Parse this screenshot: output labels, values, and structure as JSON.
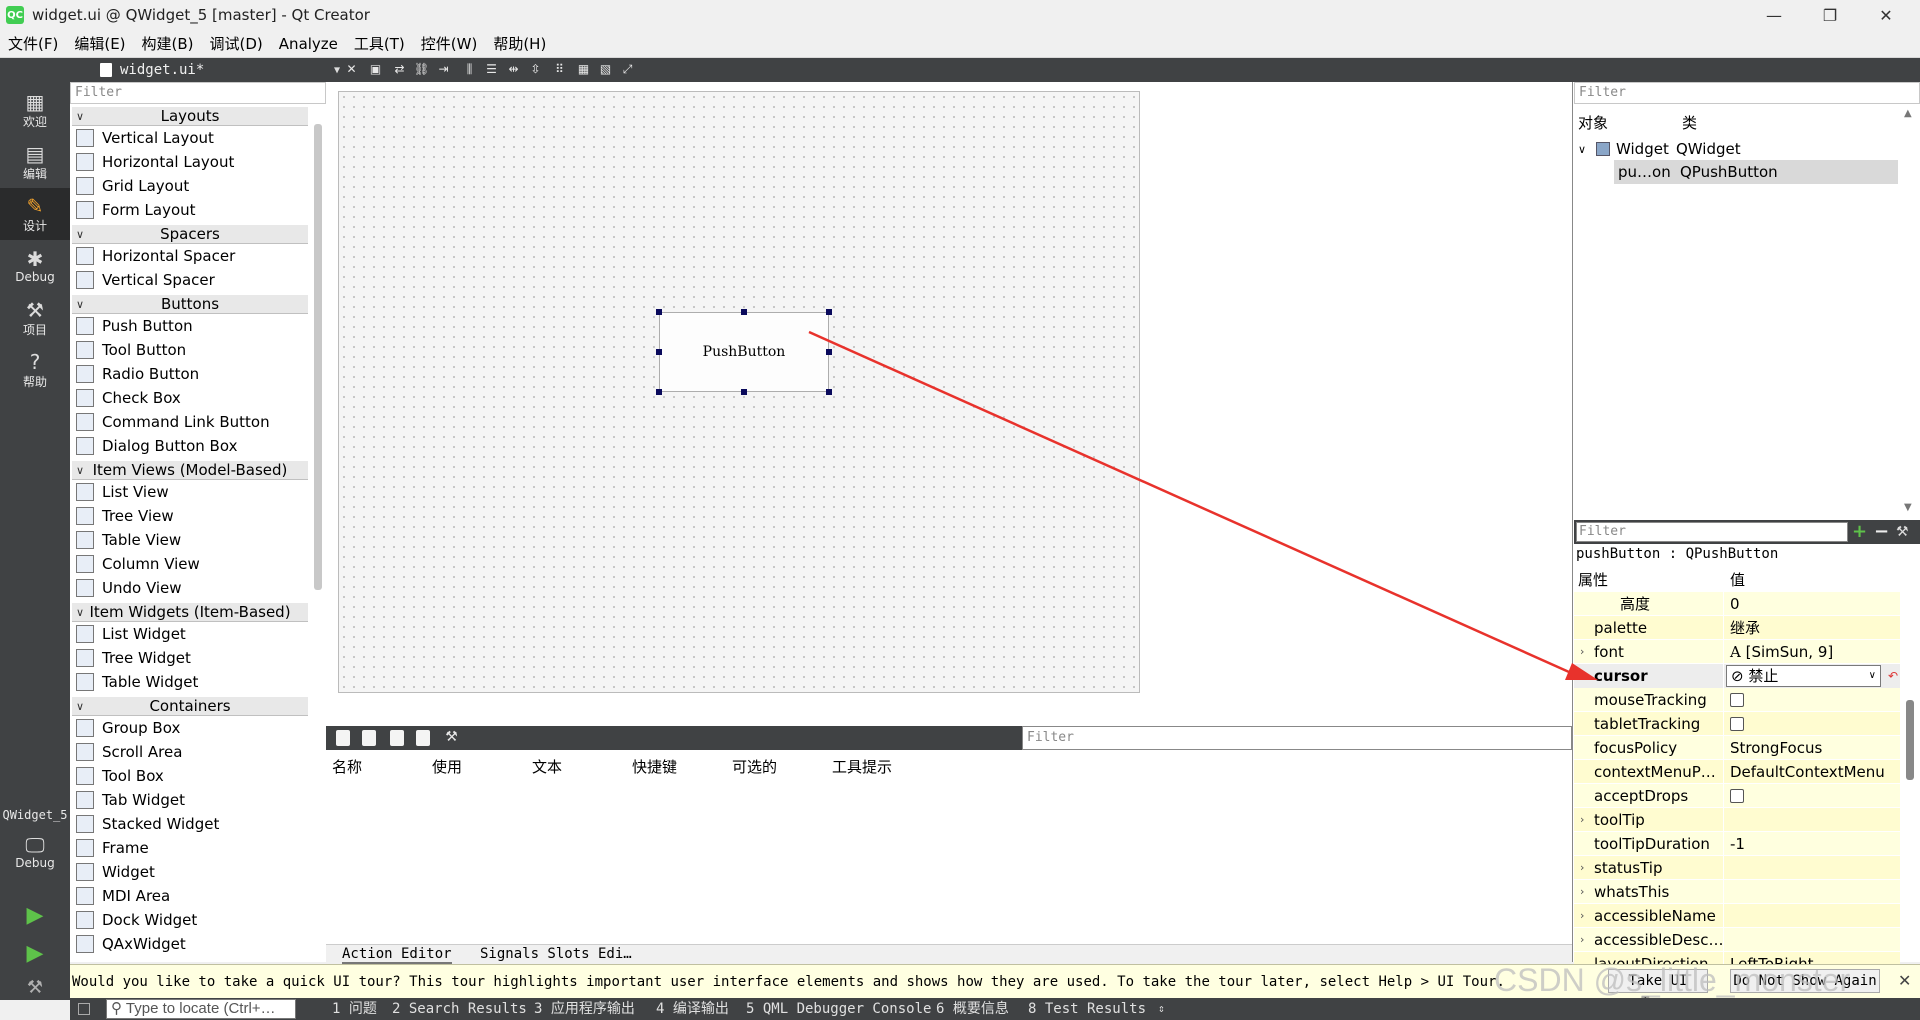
{
  "window": {
    "title": "widget.ui @ QWidget_5 [master] - Qt Creator",
    "app_icon": "QC"
  },
  "menu": [
    "文件(F)",
    "编辑(E)",
    "构建(B)",
    "调试(D)",
    "Analyze",
    "工具(T)",
    "控件(W)",
    "帮助(H)"
  ],
  "modes": [
    {
      "label": "欢迎",
      "icon": "grid-icon"
    },
    {
      "label": "编辑",
      "icon": "edit-icon"
    },
    {
      "label": "设计",
      "icon": "design-icon"
    },
    {
      "label": "Debug",
      "icon": "bug-icon"
    },
    {
      "label": "项目",
      "icon": "wrench-icon"
    },
    {
      "label": "帮助",
      "icon": "help-icon"
    }
  ],
  "project": {
    "name": "QWidget_5",
    "kit": "Debug"
  },
  "editor": {
    "file_tab": "widget.ui*"
  },
  "widgetbox": {
    "filter_placeholder": "Filter",
    "categories": [
      {
        "name": "Layouts",
        "items": [
          "Vertical Layout",
          "Horizontal Layout",
          "Grid Layout",
          "Form Layout"
        ]
      },
      {
        "name": "Spacers",
        "items": [
          "Horizontal Spacer",
          "Vertical Spacer"
        ]
      },
      {
        "name": "Buttons",
        "items": [
          "Push Button",
          "Tool Button",
          "Radio Button",
          "Check Box",
          "Command Link Button",
          "Dialog Button Box"
        ]
      },
      {
        "name": "Item Views (Model-Based)",
        "items": [
          "List View",
          "Tree View",
          "Table View",
          "Column View",
          "Undo View"
        ]
      },
      {
        "name": "Item Widgets (Item-Based)",
        "items": [
          "List Widget",
          "Tree Widget",
          "Table Widget"
        ]
      },
      {
        "name": "Containers",
        "items": [
          "Group Box",
          "Scroll Area",
          "Tool Box",
          "Tab Widget",
          "Stacked Widget",
          "Frame",
          "Widget",
          "MDI Area",
          "Dock Widget",
          "QAxWidget"
        ]
      }
    ]
  },
  "form": {
    "button_text": "PushButton"
  },
  "action_editor": {
    "filter_placeholder": "Filter",
    "columns": [
      "名称",
      "使用",
      "文本",
      "快捷键",
      "可选的",
      "工具提示"
    ],
    "tabs": [
      "Action Editor",
      "Signals Slots Edi…"
    ]
  },
  "object_inspector": {
    "filter_placeholder": "Filter",
    "columns": [
      "对象",
      "类"
    ],
    "rows": [
      {
        "object": "Widget",
        "class": "QWidget"
      },
      {
        "object": "pu…on",
        "class": "QPushButton"
      }
    ]
  },
  "property_editor": {
    "filter_placeholder": "Filter",
    "title": "pushButton : QPushButton",
    "columns": [
      "属性",
      "值"
    ],
    "rows": [
      {
        "name": "高度",
        "value": "0"
      },
      {
        "name": "palette",
        "value": "继承"
      },
      {
        "name": "font",
        "value": "[SimSun, 9]"
      },
      {
        "name": "cursor",
        "value": "禁止"
      },
      {
        "name": "mouseTracking",
        "value": ""
      },
      {
        "name": "tabletTracking",
        "value": ""
      },
      {
        "name": "focusPolicy",
        "value": "StrongFocus"
      },
      {
        "name": "contextMenuP…",
        "value": "DefaultContextMenu"
      },
      {
        "name": "acceptDrops",
        "value": ""
      },
      {
        "name": "toolTip",
        "value": ""
      },
      {
        "name": "toolTipDuration",
        "value": "-1"
      },
      {
        "name": "statusTip",
        "value": ""
      },
      {
        "name": "whatsThis",
        "value": ""
      },
      {
        "name": "accessibleName",
        "value": ""
      },
      {
        "name": "accessibleDesc…",
        "value": ""
      },
      {
        "name": "layoutDirection",
        "value": "LeftToRight"
      }
    ]
  },
  "tour": {
    "message": "Would you like to take a quick UI tour? This tour highlights important user interface elements and shows how they are used. To take the tour later, select Help > UI Tour.",
    "take_label": "Take UI Tour",
    "dismiss_label": "Do Not Show Again"
  },
  "statusbar": {
    "locator_placeholder": "Type to locate (Ctrl+…",
    "items": [
      "1 问题",
      "2 Search Results",
      "3 应用程序输出",
      "4 编译输出",
      "5 QML Debugger Console",
      "6 概要信息",
      "8 Test Results"
    ]
  },
  "watermark": "CSDN @s_little_monster",
  "colors": {
    "arrow": "#e8322c",
    "sidebar": "#404244",
    "active_mode_icon": "#f3a32c"
  }
}
